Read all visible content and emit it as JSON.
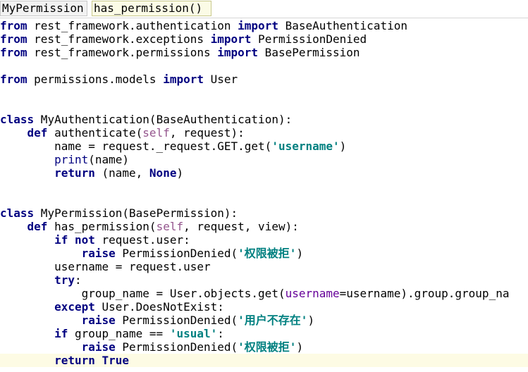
{
  "breadcrumb": {
    "items": [
      {
        "label": "MyPermission",
        "kind": "class"
      },
      {
        "label": "has_permission()",
        "kind": "func"
      }
    ]
  },
  "colors": {
    "keyword": "#000080",
    "string": "#008080",
    "self": "#94558d",
    "builtin": "#000080",
    "kwarg": "#660099",
    "text": "#000000",
    "current_line": "#fdfbe4"
  },
  "editor": {
    "current_line": 26,
    "lines": [
      [
        [
          "kw",
          "from"
        ],
        [
          "plain",
          " rest_framework.authentication "
        ],
        [
          "kw",
          "import"
        ],
        [
          "plain",
          " BaseAuthentication"
        ]
      ],
      [
        [
          "kw",
          "from"
        ],
        [
          "plain",
          " rest_framework.exceptions "
        ],
        [
          "kw",
          "import"
        ],
        [
          "plain",
          " PermissionDenied"
        ]
      ],
      [
        [
          "kw",
          "from"
        ],
        [
          "plain",
          " rest_framework.permissions "
        ],
        [
          "kw",
          "import"
        ],
        [
          "plain",
          " BasePermission"
        ]
      ],
      [],
      [
        [
          "kw",
          "from"
        ],
        [
          "plain",
          " permissions.models "
        ],
        [
          "kw",
          "import"
        ],
        [
          "plain",
          " User"
        ]
      ],
      [],
      [],
      [
        [
          "kw",
          "class"
        ],
        [
          "plain",
          " MyAuthentication(BaseAuthentication):"
        ]
      ],
      [
        [
          "plain",
          "    "
        ],
        [
          "kw",
          "def"
        ],
        [
          "plain",
          " authenticate("
        ],
        [
          "self",
          "self"
        ],
        [
          "plain",
          ", request):"
        ]
      ],
      [
        [
          "plain",
          "        name = request._request.GET.get("
        ],
        [
          "str",
          "'username'"
        ],
        [
          "plain",
          ")"
        ]
      ],
      [
        [
          "plain",
          "        "
        ],
        [
          "builtin",
          "print"
        ],
        [
          "plain",
          "(name)"
        ]
      ],
      [
        [
          "plain",
          "        "
        ],
        [
          "kw",
          "return"
        ],
        [
          "plain",
          " (name, "
        ],
        [
          "kw",
          "None"
        ],
        [
          "plain",
          ")"
        ]
      ],
      [],
      [],
      [
        [
          "kw",
          "class"
        ],
        [
          "plain",
          " MyPermission(BasePermission):"
        ]
      ],
      [
        [
          "plain",
          "    "
        ],
        [
          "kw",
          "def"
        ],
        [
          "plain",
          " has_permission("
        ],
        [
          "self",
          "self"
        ],
        [
          "plain",
          ", request, view):"
        ]
      ],
      [
        [
          "plain",
          "        "
        ],
        [
          "kw",
          "if not"
        ],
        [
          "plain",
          " request.user:"
        ]
      ],
      [
        [
          "plain",
          "            "
        ],
        [
          "kw",
          "raise"
        ],
        [
          "plain",
          " PermissionDenied("
        ],
        [
          "str",
          "'权限被拒'"
        ],
        [
          "plain",
          ")"
        ]
      ],
      [
        [
          "plain",
          "        username = request.user"
        ]
      ],
      [
        [
          "plain",
          "        "
        ],
        [
          "kw",
          "try"
        ],
        [
          "plain",
          ":"
        ]
      ],
      [
        [
          "plain",
          "            group_name = User.objects.get("
        ],
        [
          "kwarg",
          "username"
        ],
        [
          "plain",
          "=username).group.group_na"
        ]
      ],
      [
        [
          "plain",
          "        "
        ],
        [
          "kw",
          "except"
        ],
        [
          "plain",
          " User.DoesNotExist:"
        ]
      ],
      [
        [
          "plain",
          "            "
        ],
        [
          "kw",
          "raise"
        ],
        [
          "plain",
          " PermissionDenied("
        ],
        [
          "str",
          "'用户不存在'"
        ],
        [
          "plain",
          ")"
        ]
      ],
      [
        [
          "plain",
          "        "
        ],
        [
          "kw",
          "if"
        ],
        [
          "plain",
          " group_name == "
        ],
        [
          "str",
          "'usual'"
        ],
        [
          "plain",
          ":"
        ]
      ],
      [
        [
          "plain",
          "            "
        ],
        [
          "kw",
          "raise"
        ],
        [
          "plain",
          " PermissionDenied("
        ],
        [
          "str",
          "'权限被拒'"
        ],
        [
          "plain",
          ")"
        ]
      ],
      [
        [
          "plain",
          "        "
        ],
        [
          "kw",
          "return True"
        ]
      ]
    ]
  }
}
